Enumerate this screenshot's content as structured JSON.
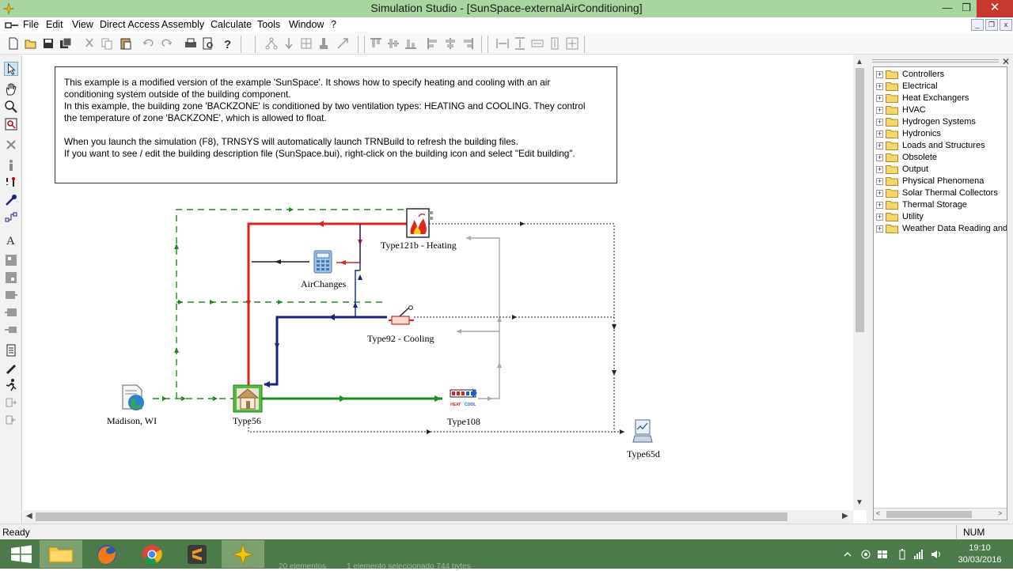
{
  "window": {
    "title": "Simulation Studio - [SunSpace-externalAirConditioning]",
    "minimize_glyph": "—",
    "restore_glyph": "❐",
    "close_glyph": "✕"
  },
  "menu": {
    "items": [
      "File",
      "Edit",
      "View",
      "Direct Access",
      "Assembly",
      "Calculate",
      "Tools",
      "Window",
      "?"
    ]
  },
  "toolbar": {
    "icons": [
      "new-icon",
      "open-icon",
      "save-icon",
      "save-all-icon",
      "cut-icon",
      "copy-icon",
      "paste-icon",
      "undo-icon",
      "redo-icon",
      "print-icon",
      "print-preview-icon",
      "help-icon",
      "macro-icon",
      "link-icon",
      "table-icon",
      "probe-icon",
      "exporter-icon",
      "align-top-icon",
      "align-middle-icon",
      "align-bottom-icon",
      "align-left-icon",
      "align-center-icon",
      "align-right-icon",
      "space-horizontal-icon",
      "space-vertical-icon",
      "same-width-icon",
      "same-height-icon",
      "same-size-icon"
    ]
  },
  "left_tools": {
    "icons": [
      "select-pointer-icon",
      "pan-hand-icon",
      "zoom-icon",
      "zoom-window-icon",
      "delete-icon",
      "info-icon",
      "connection-icon",
      "link-tool-icon",
      "link-break-icon",
      "text-tool-icon",
      "group-icon",
      "ungroup-icon",
      "macro-tool-icon",
      "macro-out-icon",
      "plugin-icon",
      "document-icon",
      "pen-icon",
      "run-icon",
      "output-tool-icon",
      "input-tool-icon"
    ]
  },
  "info_box": {
    "line1": "This example is a modified version of the example 'SunSpace'.  It shows how to specify heating and cooling with an air",
    "line2": "conditioning system outside of the building component.",
    "line3": "In this example, the building zone 'BACKZONE' is conditioned by two ventilation types: HEATING and COOLING.  They control",
    "line4": "the temperature of zone 'BACKZONE', which is allowed to float.",
    "line5": "When you launch the simulation (F8), TRNSYS will automatically launch TRNBuild to refresh the building files.",
    "line6": "If you want to see / edit the building description file (SunSpace.bui), right-click on the building icon and select \"Edit building\"."
  },
  "components": {
    "weather": "Madison, WI",
    "building": "Type56",
    "heating": "Type121b - Heating",
    "air_changes": "AirChanges",
    "cooling": "Type92 - Cooling",
    "energy": "Type108",
    "plotter": "Type65d",
    "heat_badge": "HEAT",
    "cool_badge": "COOL"
  },
  "colors": {
    "heating_link": "#d9231d",
    "cooling_link": "#1a237e",
    "weather_link": "#1e8a1e",
    "output_link": "#000000",
    "control_link": "#a9a9a9",
    "title_bar": "#a8d5a0",
    "taskbar": "#4d7a4b"
  },
  "library_tree": {
    "items": [
      "Controllers",
      "Electrical",
      "Heat Exchangers",
      "HVAC",
      "Hydrogen Systems",
      "Hydronics",
      "Loads and Structures",
      "Obsolete",
      "Output",
      "Physical Phenomena",
      "Solar Thermal Collectors",
      "Thermal Storage",
      "Utility",
      "Weather Data Reading and F"
    ]
  },
  "status": {
    "text": "Ready",
    "num": "NUM"
  },
  "taskbar": {
    "apps": [
      "windows-start-icon",
      "file-explorer-icon",
      "firefox-icon",
      "chrome-icon",
      "sublime-text-icon",
      "simulation-studio-icon"
    ],
    "ghost_text_1": "20 elementos",
    "ghost_text_2": "1 elemento seleccionado  744 bytes",
    "time": "19:10",
    "date": "30/03/2016"
  }
}
